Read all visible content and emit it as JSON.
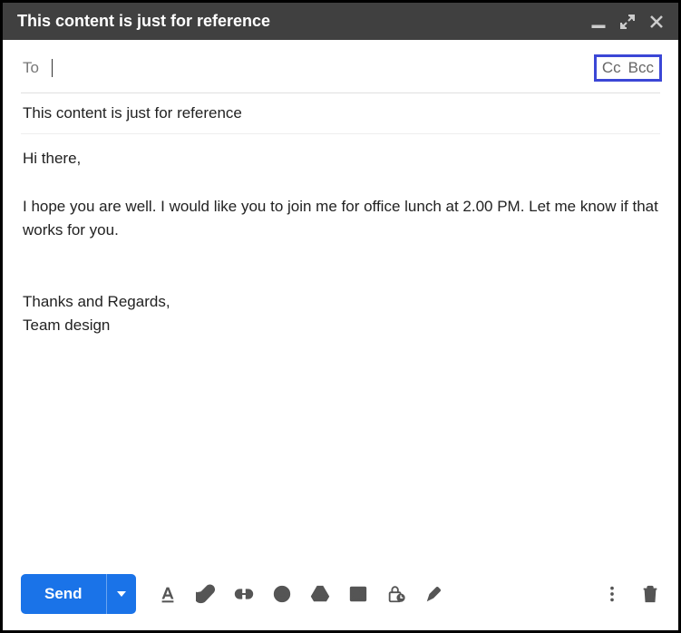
{
  "header": {
    "title": "This content is just for reference"
  },
  "to": {
    "label": "To",
    "value": "",
    "cc_label": "Cc",
    "bcc_label": "Bcc"
  },
  "subject": "This content is just for reference",
  "body": "Hi there,\n\nI hope you are well. I would like you to join me for office lunch at 2.00 PM. Let me know if that works for you.\n\n\nThanks and Regards,\nTeam design",
  "footer": {
    "send_label": "Send"
  }
}
